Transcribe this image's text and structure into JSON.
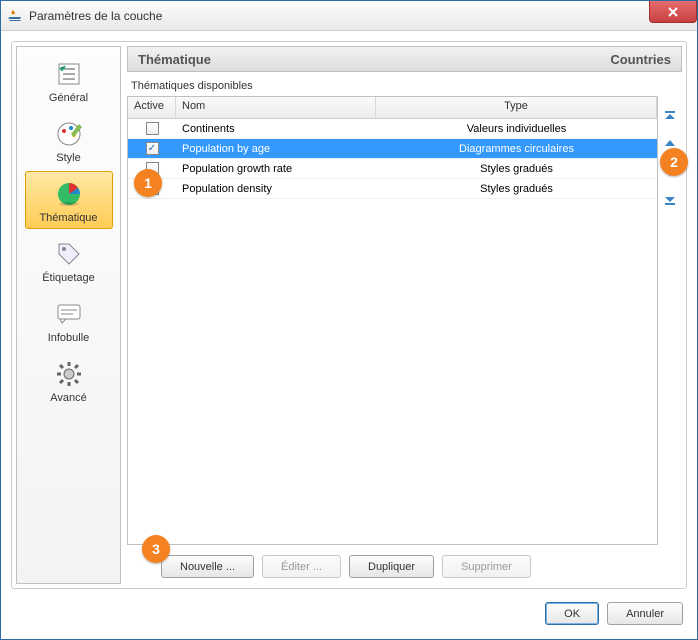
{
  "window": {
    "title": "Paramètres de la couche"
  },
  "sidebar": {
    "items": [
      {
        "label": "Général"
      },
      {
        "label": "Style"
      },
      {
        "label": "Thématique"
      },
      {
        "label": "Étiquetage"
      },
      {
        "label": "Infobulle"
      },
      {
        "label": "Avancé"
      }
    ],
    "selected_index": 2
  },
  "header": {
    "section": "Thématique",
    "layer": "Countries"
  },
  "subtitle": "Thématiques disponibles",
  "table": {
    "columns": {
      "active": "Active",
      "nom": "Nom",
      "type": "Type"
    },
    "rows": [
      {
        "active": false,
        "nom": "Continents",
        "type": "Valeurs individuelles",
        "selected": false
      },
      {
        "active": true,
        "nom": "Population by age",
        "type": "Diagrammes circulaires",
        "selected": true
      },
      {
        "active": false,
        "nom": "Population growth rate",
        "type": "Styles gradués",
        "selected": false
      },
      {
        "active": true,
        "nom": "Population density",
        "type": "Styles gradués",
        "selected": false
      }
    ],
    "selected_index": 1
  },
  "reorder_icons": [
    "move-top-icon",
    "move-up-icon",
    "move-down-icon",
    "move-bottom-icon"
  ],
  "buttons": {
    "new": "Nouvelle ...",
    "edit": "Éditer ...",
    "duplicate": "Dupliquer",
    "delete": "Supprimer",
    "ok": "OK",
    "cancel": "Annuler"
  },
  "callouts": {
    "c1": "1",
    "c2": "2",
    "c3": "3"
  },
  "colors": {
    "accent": "#f58220",
    "selection": "#3399ff"
  }
}
